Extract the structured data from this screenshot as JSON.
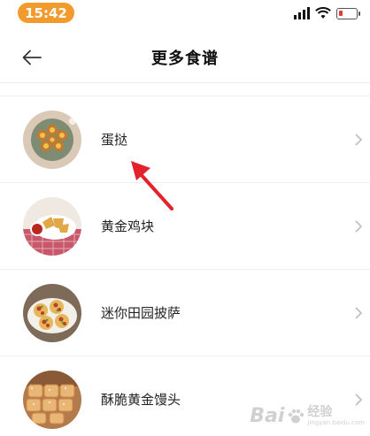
{
  "status_bar": {
    "time": "15:42",
    "network": "4G",
    "battery_level": 0.15,
    "colors": {
      "time_pill": "#f39a2c",
      "battery_low": "#e53935"
    }
  },
  "header": {
    "back_icon": "arrow-left-icon",
    "title": "更多食谱"
  },
  "recipes": [
    {
      "name": "蛋挞",
      "thumb": "egg-tart-photo"
    },
    {
      "name": "黄金鸡块",
      "thumb": "chicken-nuggets-photo"
    },
    {
      "name": "迷你田园披萨",
      "thumb": "mini-pizza-photo"
    },
    {
      "name": "酥脆黄金馒头",
      "thumb": "golden-buns-photo"
    }
  ],
  "annotation": {
    "arrow_color": "#e3232c"
  },
  "watermark": {
    "brand": "Bai",
    "suffix": "经验",
    "url": "jingyan.baidu.com"
  }
}
